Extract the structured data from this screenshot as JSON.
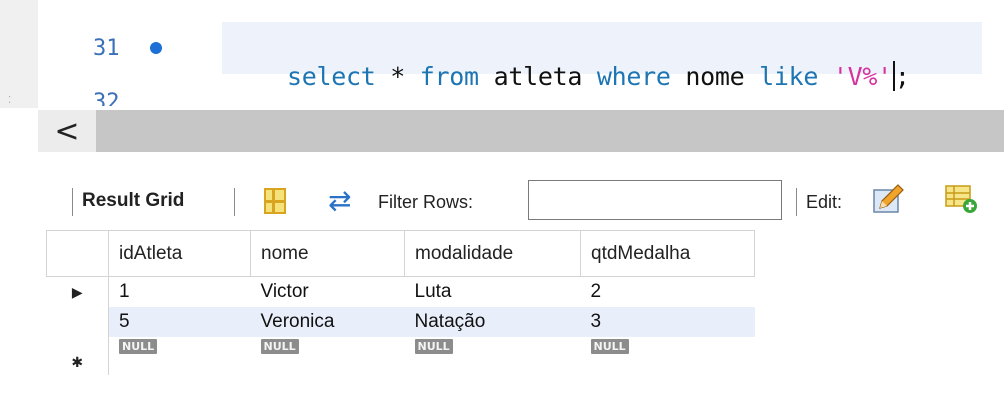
{
  "editor": {
    "lines": [
      {
        "number": "31",
        "has_bullet": true
      },
      {
        "number": "32",
        "has_bullet": false
      }
    ],
    "code_tokens": [
      {
        "text": "select",
        "kind": "kw"
      },
      {
        "text": " * ",
        "kind": "plain"
      },
      {
        "text": "from",
        "kind": "kw"
      },
      {
        "text": " atleta ",
        "kind": "plain"
      },
      {
        "text": "where",
        "kind": "kw"
      },
      {
        "text": " nome ",
        "kind": "plain"
      },
      {
        "text": "like",
        "kind": "kw"
      },
      {
        "text": " ",
        "kind": "plain"
      },
      {
        "text": "'V%'",
        "kind": "str"
      },
      {
        "text": ";",
        "kind": "plain"
      }
    ]
  },
  "scrollbar": {
    "left_arrow": "<"
  },
  "toolbar": {
    "result_grid_label": "Result Grid",
    "filter_label": "Filter Rows:",
    "filter_value": "",
    "edit_label": "Edit:"
  },
  "grid": {
    "columns": [
      "idAtleta",
      "nome",
      "modalidade",
      "qtdMedalha"
    ],
    "rows": [
      {
        "cells": [
          "1",
          "Victor",
          "Luta",
          "2"
        ],
        "selected": true
      },
      {
        "cells": [
          "5",
          "Veronica",
          "Natação",
          "3"
        ],
        "selected": false
      }
    ],
    "new_row": [
      "NULL",
      "NULL",
      "NULL",
      "NULL"
    ]
  },
  "icons": {
    "bullet": "breakpoint-dot-icon",
    "grid": "grid-view-icon",
    "refresh": "refresh-icon",
    "edit": "edit-pencil-icon",
    "add_row": "add-row-icon",
    "row_arrow": "current-row-arrow-icon",
    "new_row": "new-row-star-icon"
  },
  "colors": {
    "keyword": "#1d75b3",
    "string": "#d6319f",
    "line_number": "#3a70b8",
    "alt_row": "#e9effa"
  }
}
